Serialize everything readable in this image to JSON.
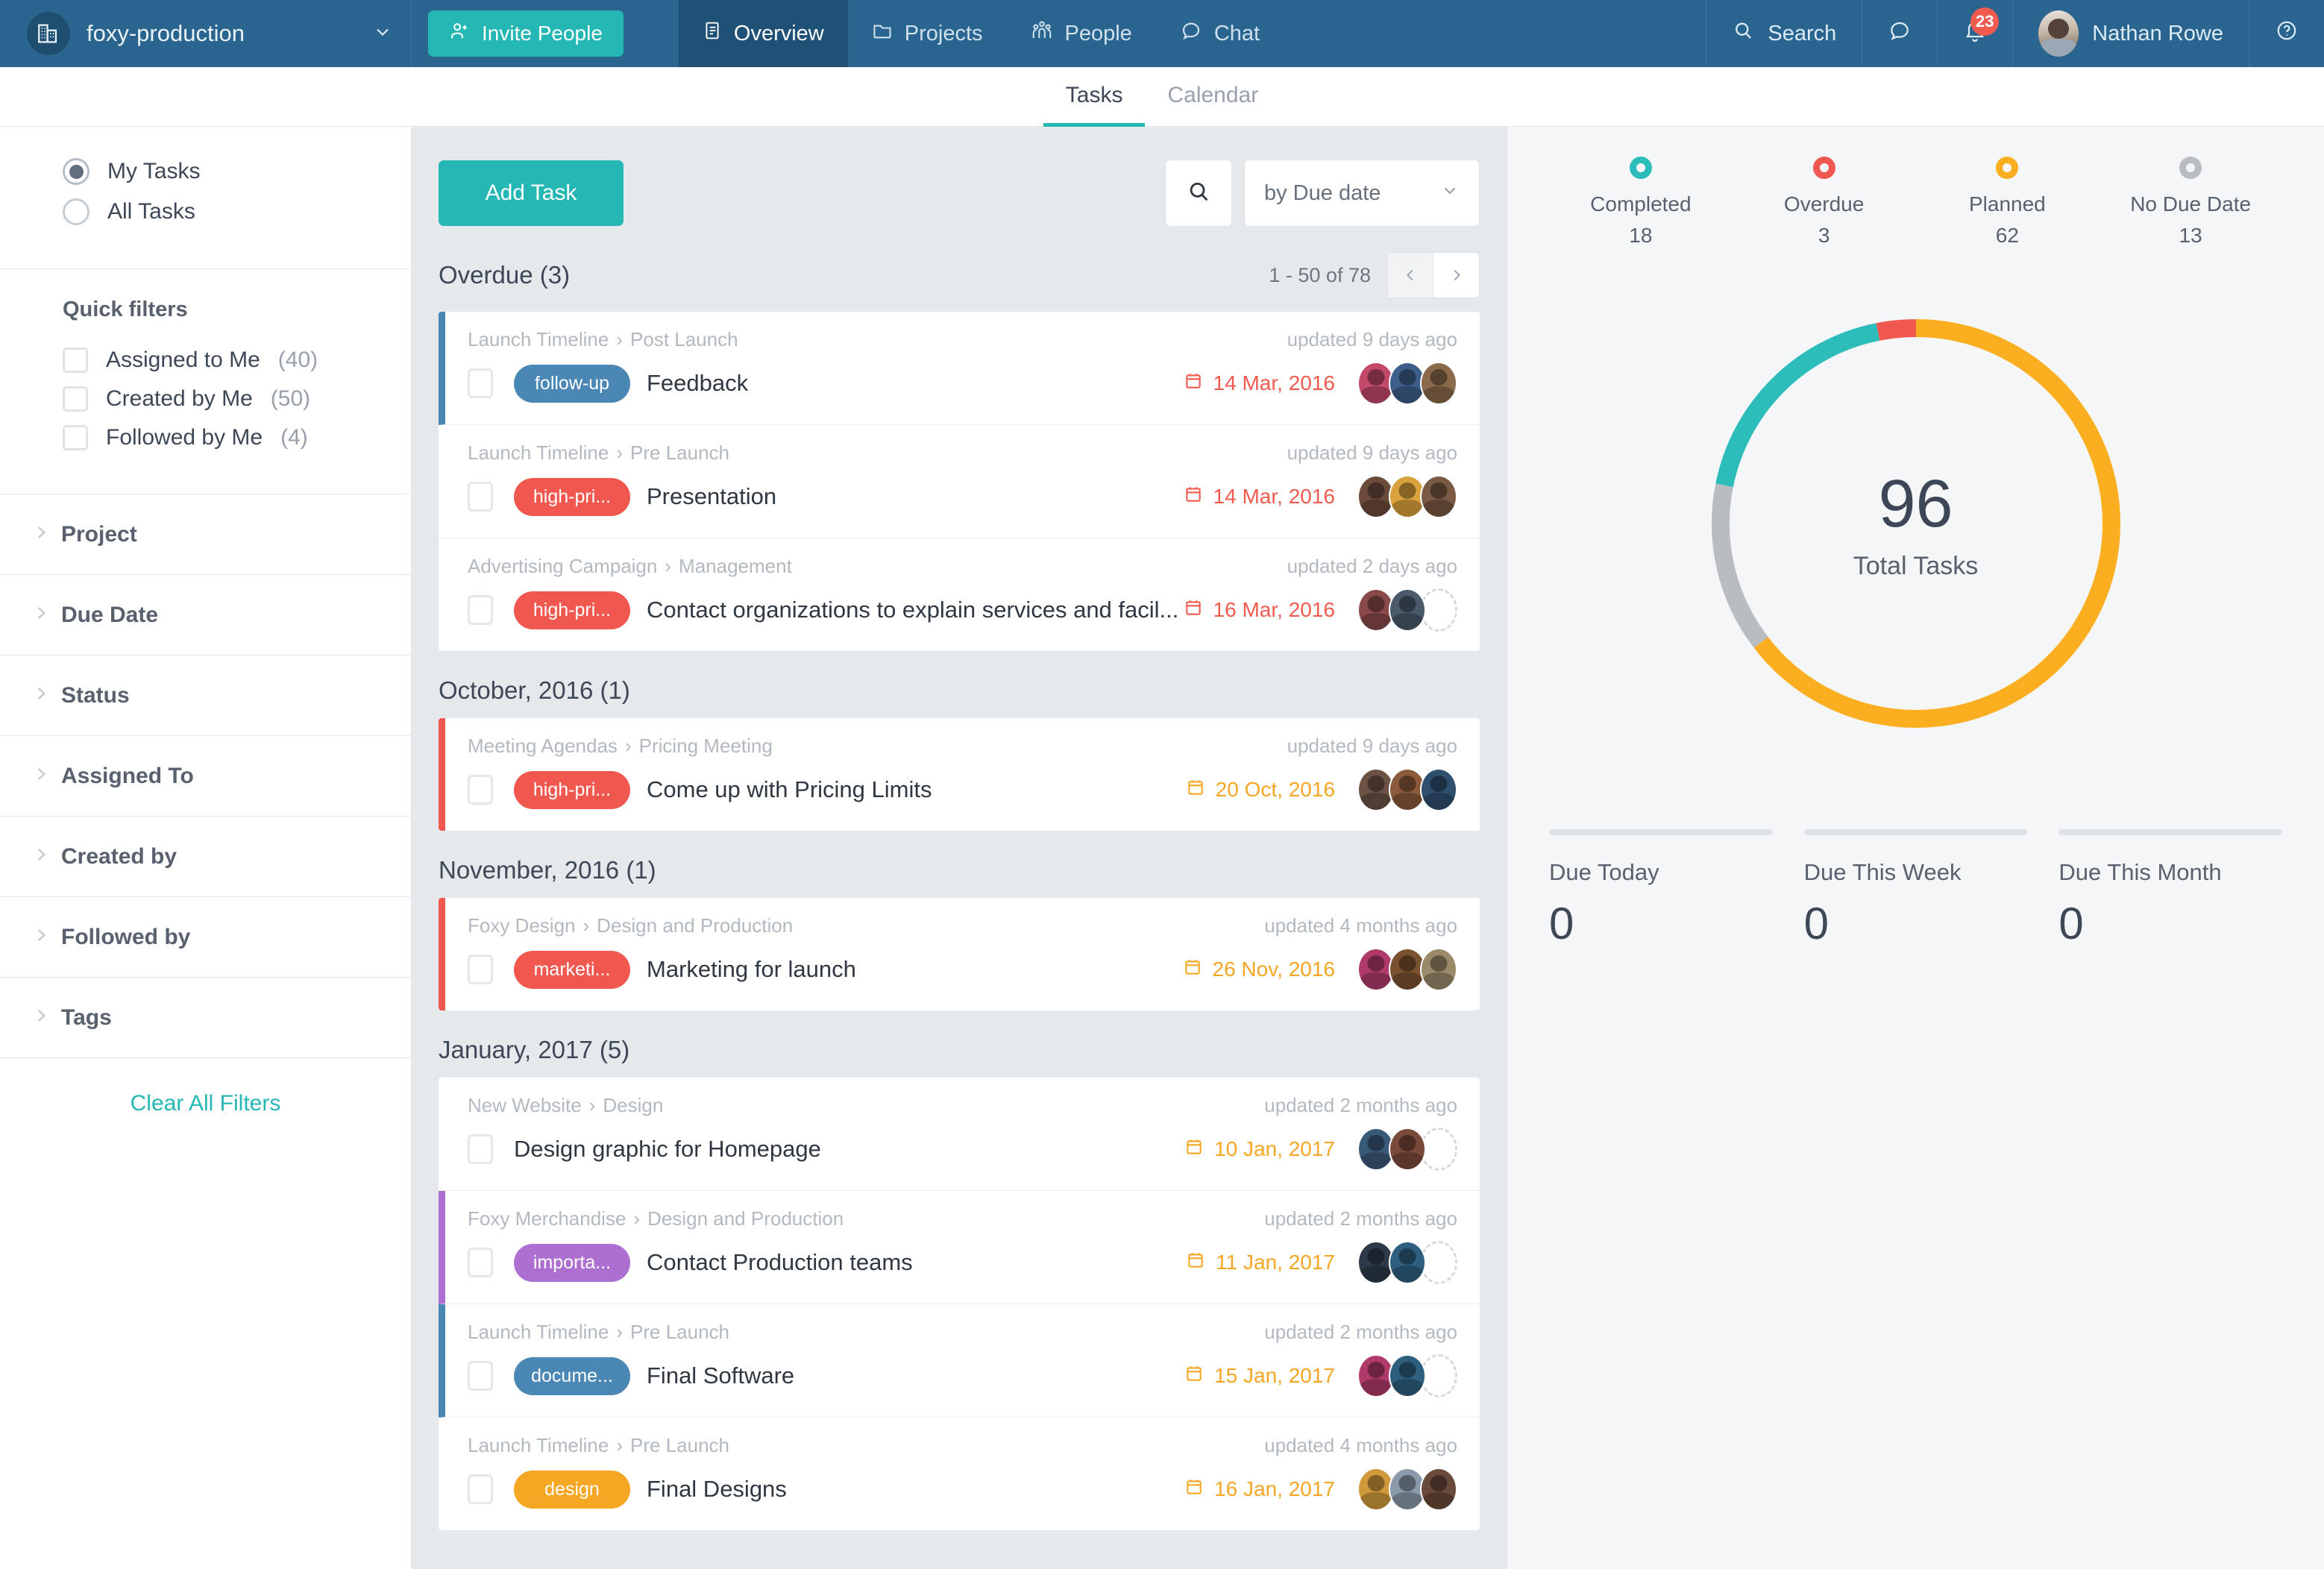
{
  "topbar": {
    "org_name": "foxy-production",
    "org_logo_icon": "buildings-icon",
    "org_caret_icon": "chevron-down-icon",
    "invite_label": "Invite People",
    "invite_icon": "add-person-icon",
    "nav": [
      {
        "label": "Overview",
        "icon": "document-icon",
        "active": true
      },
      {
        "label": "Projects",
        "icon": "folder-icon",
        "active": false
      },
      {
        "label": "People",
        "icon": "people-icon",
        "active": false
      },
      {
        "label": "Chat",
        "icon": "chat-bubble-icon",
        "active": false
      }
    ],
    "search_label": "Search",
    "search_icon": "search-icon",
    "messages_icon": "chat-bubble-icon",
    "notifications_icon": "bell-icon",
    "notifications_count": "23",
    "user_name": "Nathan Rowe",
    "avatar_icon": "user-avatar",
    "help_icon": "question-mark-icon"
  },
  "subtabs": [
    {
      "label": "Tasks",
      "active": true
    },
    {
      "label": "Calendar",
      "active": false
    }
  ],
  "sidebar": {
    "scope": [
      {
        "label": "My Tasks",
        "selected": true
      },
      {
        "label": "All Tasks",
        "selected": false
      }
    ],
    "quick_filters_title": "Quick filters",
    "quick_filters": [
      {
        "label": "Assigned to Me",
        "count": "(40)"
      },
      {
        "label": "Created by Me",
        "count": "(50)"
      },
      {
        "label": "Followed by Me",
        "count": "(4)"
      }
    ],
    "accordions": [
      {
        "label": "Project"
      },
      {
        "label": "Due Date"
      },
      {
        "label": "Status"
      },
      {
        "label": "Assigned To"
      },
      {
        "label": "Created by"
      },
      {
        "label": "Followed by"
      },
      {
        "label": "Tags"
      }
    ],
    "clear_filters_label": "Clear All Filters"
  },
  "toolbar": {
    "add_task_label": "Add Task",
    "search_icon": "search-icon",
    "sort_value": "by Due date",
    "sort_caret_icon": "chevron-down-icon"
  },
  "pagination": {
    "range_label": "1 - 50 of 78",
    "prev_icon": "chevron-left-icon",
    "next_icon": "chevron-right-icon"
  },
  "groups": [
    {
      "title": "Overdue (3)",
      "show_pager": true,
      "tasks": [
        {
          "breadcrumb_parent": "Launch Timeline",
          "breadcrumb_child": "Post Launch",
          "updated": "updated 9 days ago",
          "tag": "follow-up",
          "tag_color": "#4a87b4",
          "title": "Feedback",
          "date": "14 Mar, 2016",
          "date_color": "#f05a4f",
          "accent": "#4a87b4",
          "avatars": [
            "#c14a6a",
            "#3d5f8a",
            "#8a6a4a"
          ],
          "empty_avatar": false
        },
        {
          "breadcrumb_parent": "Launch Timeline",
          "breadcrumb_child": "Pre Launch",
          "updated": "updated 9 days ago",
          "tag": "high-pri...",
          "tag_color": "#f0584f",
          "title": "Presentation",
          "date": "14 Mar, 2016",
          "date_color": "#f05a4f",
          "accent": "transparent",
          "avatars": [
            "#6b4b3a",
            "#d9a23c",
            "#7a5a44"
          ],
          "empty_avatar": false
        },
        {
          "breadcrumb_parent": "Advertising Campaign",
          "breadcrumb_child": "Management",
          "updated": "updated 2 days ago",
          "tag": "high-pri...",
          "tag_color": "#f0584f",
          "title": "Contact organizations to explain services and facil...",
          "date": "16 Mar, 2016",
          "date_color": "#f05a4f",
          "accent": "transparent",
          "avatars": [
            "#8a4a4a",
            "#4a5a6a"
          ],
          "empty_avatar": true
        }
      ]
    },
    {
      "title": "October, 2016 (1)",
      "show_pager": false,
      "tasks": [
        {
          "breadcrumb_parent": "Meeting Agendas",
          "breadcrumb_child": "Pricing Meeting",
          "updated": "updated 9 days ago",
          "tag": "high-pri...",
          "tag_color": "#f0584f",
          "title": "Come up with Pricing Limits",
          "date": "20 Oct, 2016",
          "date_color": "#f5a623",
          "accent": "#f0584f",
          "avatars": [
            "#6b5244",
            "#8a5a3a",
            "#2f4f6f"
          ],
          "empty_avatar": false
        }
      ]
    },
    {
      "title": "November, 2016 (1)",
      "show_pager": false,
      "tasks": [
        {
          "breadcrumb_parent": "Foxy Design",
          "breadcrumb_child": "Design and Production",
          "updated": "updated 4 months ago",
          "tag": "marketi...",
          "tag_color": "#f0584f",
          "title": "Marketing for launch",
          "date": "26 Nov, 2016",
          "date_color": "#f5a623",
          "accent": "#f0584f",
          "avatars": [
            "#b03a6a",
            "#7a5230",
            "#9a8a6a"
          ],
          "empty_avatar": false
        }
      ]
    },
    {
      "title": "January, 2017 (5)",
      "show_pager": false,
      "tasks": [
        {
          "breadcrumb_parent": "New Website",
          "breadcrumb_child": "Design",
          "updated": "updated 2 months ago",
          "tag": "",
          "tag_color": "",
          "title": "Design graphic for Homepage",
          "date": "10 Jan, 2017",
          "date_color": "#f5a623",
          "accent": "transparent",
          "avatars": [
            "#3a5a7a",
            "#7a4a3a"
          ],
          "empty_avatar": true
        },
        {
          "breadcrumb_parent": "Foxy Merchandise",
          "breadcrumb_child": "Design and Production",
          "updated": "updated 2 months ago",
          "tag": "importa...",
          "tag_color": "#ad6fd0",
          "title": "Contact Production teams",
          "date": "11 Jan, 2017",
          "date_color": "#f5a623",
          "accent": "#ad6fd0",
          "avatars": [
            "#2d3a4a",
            "#2f5f7f"
          ],
          "empty_avatar": true
        },
        {
          "breadcrumb_parent": "Launch Timeline",
          "breadcrumb_child": "Pre Launch",
          "updated": "updated 2 months ago",
          "tag": "docume...",
          "tag_color": "#4a87b4",
          "title": "Final Software",
          "date": "15 Jan, 2017",
          "date_color": "#f5a623",
          "accent": "#4a87b4",
          "avatars": [
            "#b03a6a",
            "#2f5f7f"
          ],
          "empty_avatar": true
        },
        {
          "breadcrumb_parent": "Launch Timeline",
          "breadcrumb_child": "Pre Launch",
          "updated": "updated 4 months ago",
          "tag": "design",
          "tag_color": "#f5a623",
          "title": "Final Designs",
          "date": "16 Jan, 2017",
          "date_color": "#f5a623",
          "accent": "transparent",
          "avatars": [
            "#d09a3a",
            "#8a9aaa",
            "#6a4a3a"
          ],
          "empty_avatar": false
        }
      ]
    }
  ],
  "chart_data": {
    "type": "pie",
    "title": "Total Tasks",
    "center_value": "96",
    "center_label": "Total Tasks",
    "categories": [
      "Planned",
      "No Due Date",
      "Completed",
      "Overdue"
    ],
    "values": [
      62,
      13,
      18,
      3
    ],
    "colors": [
      "#fbaf20",
      "#b9bdc2",
      "#2cbdba",
      "#f0584f"
    ],
    "legend_position": "top",
    "grid": false
  },
  "stats": [
    {
      "label": "Completed",
      "value": "18",
      "color": "#2cbdba"
    },
    {
      "label": "Overdue",
      "value": "3",
      "color": "#f0584f"
    },
    {
      "label": "Planned",
      "value": "62",
      "color": "#fbaf20"
    },
    {
      "label": "No Due Date",
      "value": "13",
      "color": "#b9bdc2"
    }
  ],
  "due_summary": [
    {
      "label": "Due Today",
      "value": "0"
    },
    {
      "label": "Due This Week",
      "value": "0"
    },
    {
      "label": "Due This Month",
      "value": "0"
    }
  ]
}
